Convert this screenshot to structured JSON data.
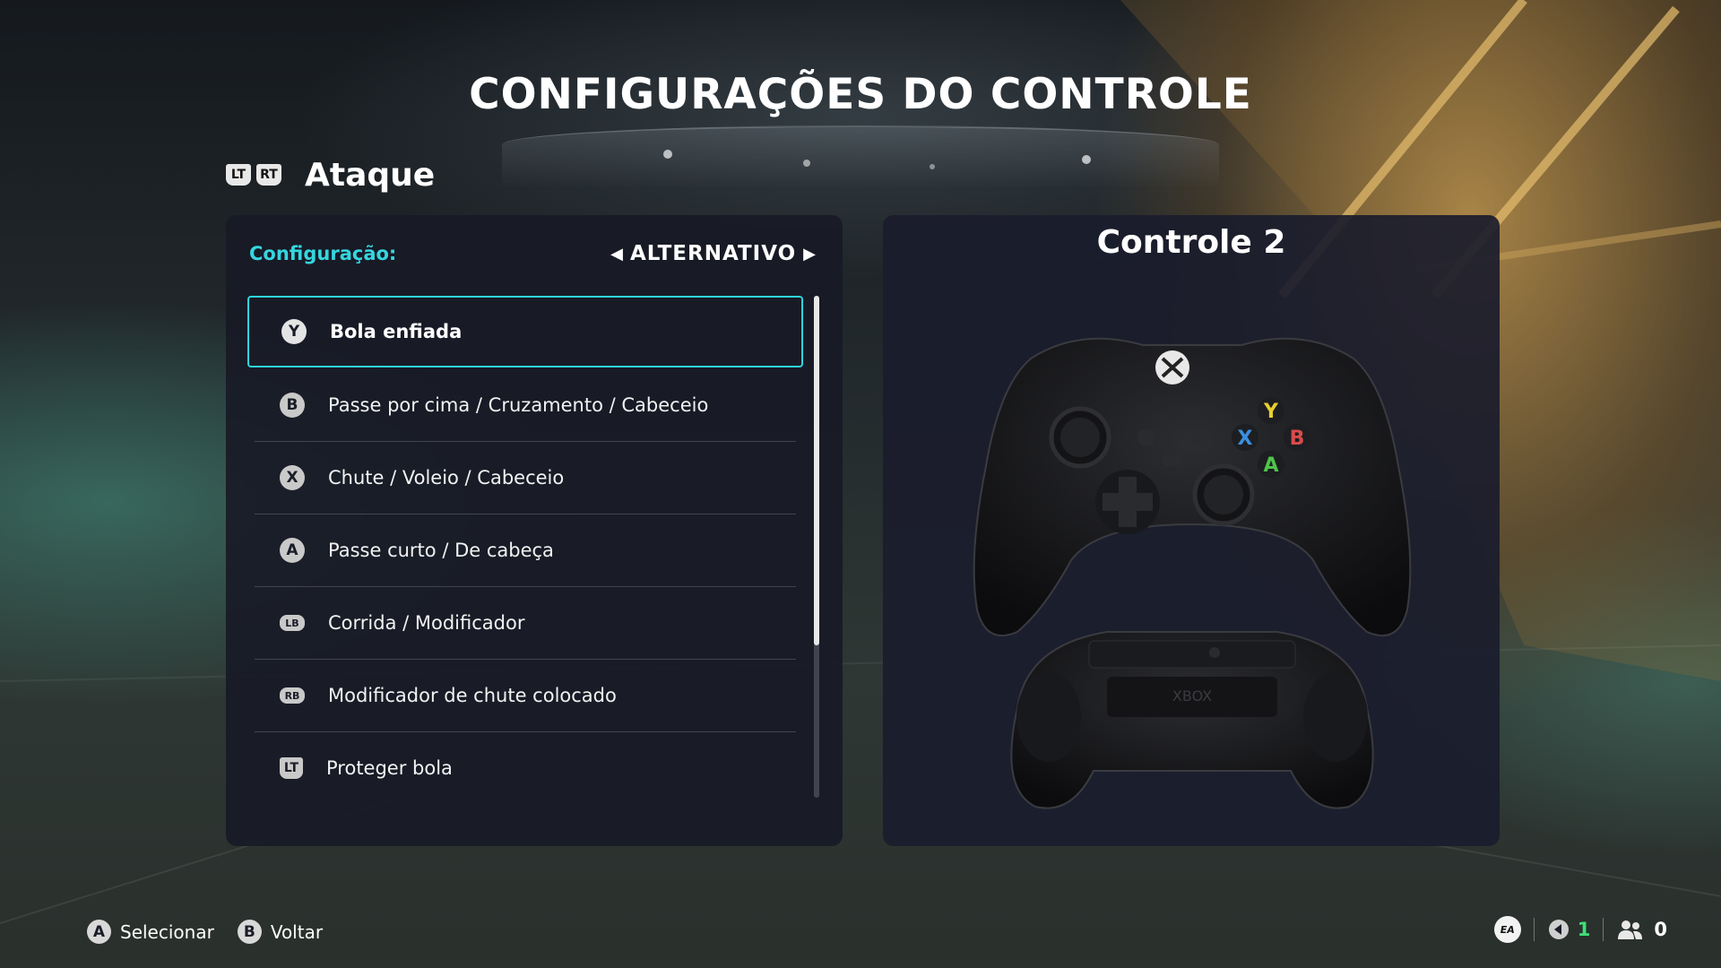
{
  "header": {
    "title": "CONFIGURAÇÕES DO CONTROLE"
  },
  "section": {
    "left_trigger": "LT",
    "right_trigger": "RT",
    "title": "Ataque"
  },
  "config": {
    "label": "Configuração:",
    "value": "ALTERNATIVO"
  },
  "controller_panel": {
    "title": "Controle 2"
  },
  "bindings": [
    {
      "button": "Y",
      "icon": "y-button-icon",
      "action": "Bola enfiada",
      "selected": true
    },
    {
      "button": "B",
      "icon": "b-button-icon",
      "action": "Passe por cima / Cruzamento / Cabeceio"
    },
    {
      "button": "X",
      "icon": "x-button-icon",
      "action": "Chute / Voleio / Cabeceio"
    },
    {
      "button": "A",
      "icon": "a-button-icon",
      "action": "Passe curto / De cabeça"
    },
    {
      "button": "LB",
      "icon": "lb-button-icon",
      "action": "Corrida / Modificador"
    },
    {
      "button": "RB",
      "icon": "rb-button-icon",
      "action": "Modificador de chute colocado"
    },
    {
      "button": "LT",
      "icon": "lt-trigger-icon",
      "action": "Proteger bola"
    }
  ],
  "controller_art": {
    "logo_text": "XBOX",
    "face_buttons": [
      "Y",
      "X",
      "B",
      "A"
    ]
  },
  "footer": {
    "hints": [
      {
        "button": "A",
        "label": "Selecionar"
      },
      {
        "button": "B",
        "label": "Voltar"
      }
    ],
    "ea_logo": "EA",
    "player_count": "1",
    "friends_count": "0"
  },
  "colors": {
    "accent": "#35d6df",
    "panel": "#181a26",
    "green": "#3fe07a"
  }
}
